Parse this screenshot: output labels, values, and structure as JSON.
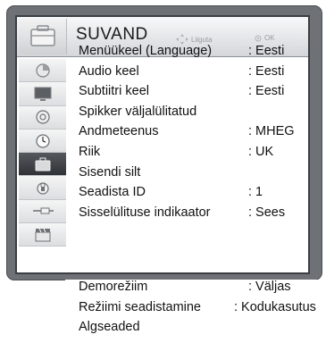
{
  "header": {
    "title": "SUVAND",
    "nav_hint": "Liiguta",
    "ok_hint": "OK"
  },
  "sidebar": {
    "items": [
      {
        "icon": "picture-icon"
      },
      {
        "icon": "tv-icon"
      },
      {
        "icon": "speaker-icon"
      },
      {
        "icon": "clock-icon"
      },
      {
        "icon": "briefcase-icon",
        "active": true
      },
      {
        "icon": "lock-icon"
      },
      {
        "icon": "usb-cable-icon"
      },
      {
        "icon": "clapperboard-icon"
      }
    ]
  },
  "menu": {
    "rows": [
      {
        "label": "Menüükeel (Language)",
        "value": ": Eesti"
      },
      {
        "label": "Audio keel",
        "value": ": Eesti"
      },
      {
        "label": "Subtiitri keel",
        "value": ": Eesti"
      },
      {
        "label": "Spikker väljalülitatud",
        "value": ""
      },
      {
        "label": "Andmeteenus",
        "value": ": MHEG"
      },
      {
        "label": "Riik",
        "value": ": UK"
      },
      {
        "label": "Sisendi silt",
        "value": ""
      },
      {
        "label": "Seadista ID",
        "value": ": 1"
      },
      {
        "label": "Sisselülituse indikaator",
        "value": ": Sees"
      },
      {
        "label": "Demorežiim",
        "value": ": Väljas"
      },
      {
        "label": "Režiimi seadistamine",
        "value": ": Kodukasutus"
      },
      {
        "label": "Algseaded",
        "value": ""
      }
    ]
  }
}
